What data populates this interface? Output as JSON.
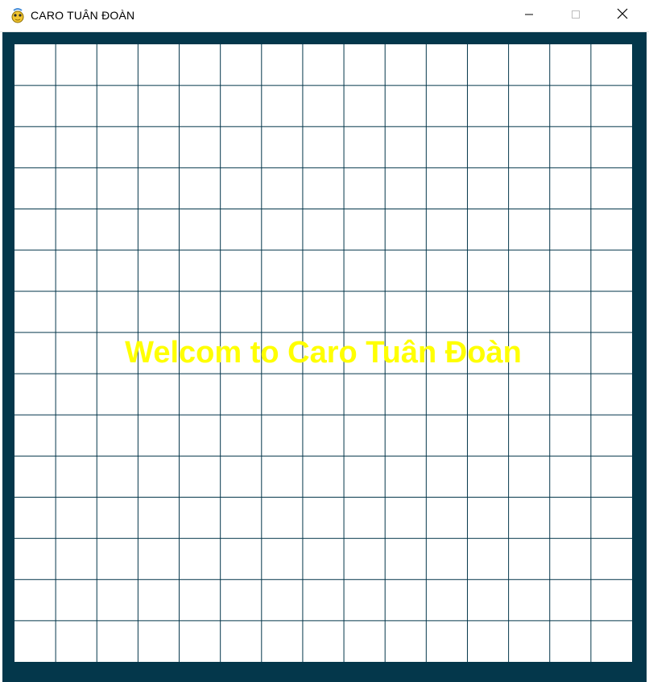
{
  "window": {
    "title": "CARO TUÂN ĐOÀN",
    "icon": "pygame-snake-icon",
    "controls": {
      "minimize": "minimize-icon",
      "maximize": "maximize-icon",
      "close": "close-icon"
    }
  },
  "game": {
    "welcome_message": "Welcom to Caro Tuân Đoàn",
    "board": {
      "rows": 15,
      "cols": 15
    },
    "colors": {
      "frame": "#04374b",
      "board_background": "#ffffff",
      "grid_line": "#04374b",
      "welcome_text": "#ffff00"
    }
  }
}
